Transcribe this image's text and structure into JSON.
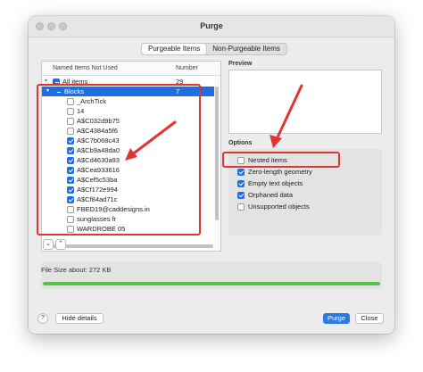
{
  "window": {
    "title": "Purge"
  },
  "tabs": [
    {
      "label": "Purgeable Items",
      "active": true
    },
    {
      "label": "Non-Purgeable Items",
      "active": false
    }
  ],
  "tree": {
    "columns": {
      "name": "Named Items Not Used",
      "number": "Number"
    },
    "rows": [
      {
        "label": "All items",
        "number": "29",
        "level": 0,
        "disclosure": "▾",
        "check": "mixed",
        "selected": false
      },
      {
        "label": "Blocks",
        "number": "7",
        "level": 1,
        "disclosure": "▾",
        "check": "mixed",
        "selected": true
      },
      {
        "label": "_ArchTick",
        "number": "",
        "level": 2,
        "check": "unchecked",
        "selected": false
      },
      {
        "label": "14",
        "number": "",
        "level": 2,
        "check": "unchecked",
        "selected": false
      },
      {
        "label": "A$C032d9b75",
        "number": "",
        "level": 2,
        "check": "unchecked",
        "selected": false
      },
      {
        "label": "A$C4384a5f6",
        "number": "",
        "level": 2,
        "check": "unchecked",
        "selected": false
      },
      {
        "label": "A$C7b068c43",
        "number": "",
        "level": 2,
        "check": "checked",
        "selected": false
      },
      {
        "label": "A$Cb9a48da0",
        "number": "",
        "level": 2,
        "check": "checked",
        "selected": false
      },
      {
        "label": "A$Cd4630a93",
        "number": "",
        "level": 2,
        "check": "checked",
        "selected": false
      },
      {
        "label": "A$Cea933616",
        "number": "",
        "level": 2,
        "check": "checked",
        "selected": false
      },
      {
        "label": "A$Cef5c53ba",
        "number": "",
        "level": 2,
        "check": "checked",
        "selected": false
      },
      {
        "label": "A$Cf172e994",
        "number": "",
        "level": 2,
        "check": "checked",
        "selected": false
      },
      {
        "label": "A$Cf84ad71c",
        "number": "",
        "level": 2,
        "check": "checked",
        "selected": false
      },
      {
        "label": "FBED19@caddesigns.in",
        "number": "",
        "level": 2,
        "check": "unchecked",
        "selected": false
      },
      {
        "label": "sunglasses fr",
        "number": "",
        "level": 2,
        "check": "unchecked",
        "selected": false
      },
      {
        "label": "WARDROBE 05",
        "number": "",
        "level": 2,
        "check": "unchecked",
        "selected": false
      }
    ]
  },
  "expand_buttons": {
    "collapse": "⌄",
    "expand": "⌃"
  },
  "preview": {
    "label": "Preview"
  },
  "options": {
    "label": "Options",
    "items": [
      {
        "label": "Nested items",
        "checked": false
      },
      {
        "label": "Zero-length geometry",
        "checked": true
      },
      {
        "label": "Empty text objects",
        "checked": true
      },
      {
        "label": "Orphaned data",
        "checked": true
      },
      {
        "label": "Unsupported objects",
        "checked": false
      }
    ]
  },
  "file_size": {
    "text": "File Size about: 272 KB",
    "progress": 1.0
  },
  "footer": {
    "help": "?",
    "hide_details": "Hide details",
    "purge": "Purge",
    "close": "Close"
  },
  "colors": {
    "accent": "#1f6fe0",
    "progress": "#55c24a",
    "annotation": "#e03535"
  }
}
